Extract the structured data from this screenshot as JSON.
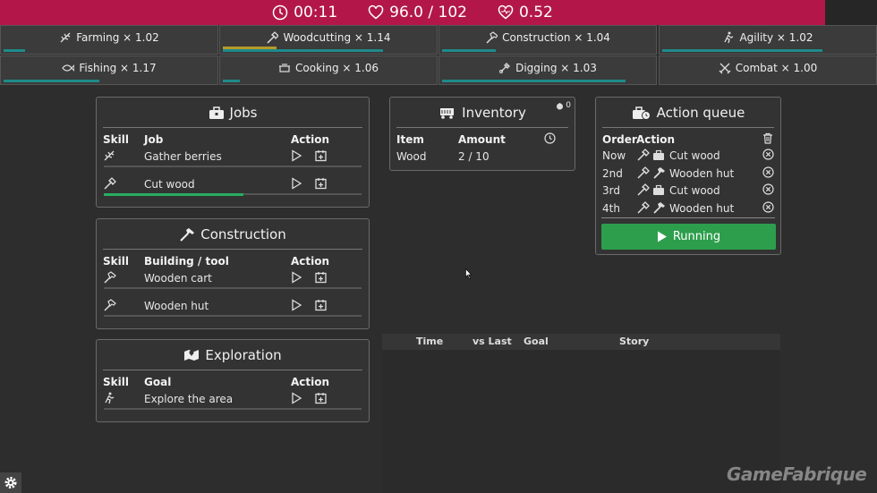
{
  "topbar": {
    "time": "00:11",
    "health": "96.0 / 102",
    "rate": "0.52"
  },
  "skills": [
    {
      "label": "Farming × 1.02",
      "icon": "farming-icon",
      "progress": 0.1
    },
    {
      "label": "Woodcutting × 1.14",
      "icon": "axe-icon",
      "progress": 0.75,
      "progress2": 0.25
    },
    {
      "label": "Construction × 1.04",
      "icon": "hammer-icon",
      "progress": 0.25
    },
    {
      "label": "Agility × 1.02",
      "icon": "runner-icon",
      "progress": 0.75
    },
    {
      "label": "Fishing × 1.17",
      "icon": "fish-icon",
      "progress": 0.45
    },
    {
      "label": "Cooking × 1.06",
      "icon": "cooking-pot-icon",
      "progress": 0.08
    },
    {
      "label": "Digging × 1.03",
      "icon": "shovel-icon",
      "progress": 0.86
    },
    {
      "label": "Combat × 1.00",
      "icon": "crossed-swords-icon",
      "progress": 0.0
    }
  ],
  "jobs": {
    "title": "Jobs",
    "headers": {
      "skill": "Skill",
      "job": "Job",
      "action": "Action"
    },
    "rows": [
      {
        "name": "Gather berries",
        "progress": 0.0
      },
      {
        "name": "Cut wood",
        "progress": 0.54
      }
    ]
  },
  "construction": {
    "title": "Construction",
    "headers": {
      "skill": "Skill",
      "item": "Building / tool",
      "action": "Action"
    },
    "rows": [
      {
        "name": "Wooden cart"
      },
      {
        "name": "Wooden hut"
      }
    ]
  },
  "exploration": {
    "title": "Exploration",
    "headers": {
      "skill": "Skill",
      "goal": "Goal",
      "action": "Action"
    },
    "rows": [
      {
        "name": "Explore the area"
      }
    ]
  },
  "inventory": {
    "title": "Inventory",
    "badge": "0",
    "headers": {
      "item": "Item",
      "amount": "Amount"
    },
    "rows": [
      {
        "item": "Wood",
        "amount": "2 / 10"
      }
    ]
  },
  "queue": {
    "title": "Action queue",
    "headers": {
      "order": "Order",
      "action": "Action"
    },
    "rows": [
      {
        "order": "Now",
        "action": "Cut wood"
      },
      {
        "order": "2nd",
        "action": "Wooden hut"
      },
      {
        "order": "3rd",
        "action": "Cut wood"
      },
      {
        "order": "4th",
        "action": "Wooden hut"
      }
    ],
    "run_label": "Running"
  },
  "story": {
    "headers": [
      "Time",
      "vs Last",
      "Goal",
      "Story"
    ]
  },
  "watermark": "GameFabrique",
  "colors": {
    "topbar": "#b3174a",
    "accent_green": "#27ae60",
    "skill_bar": "#1f8a8a",
    "woodcut_bar": "#b59a2a"
  }
}
